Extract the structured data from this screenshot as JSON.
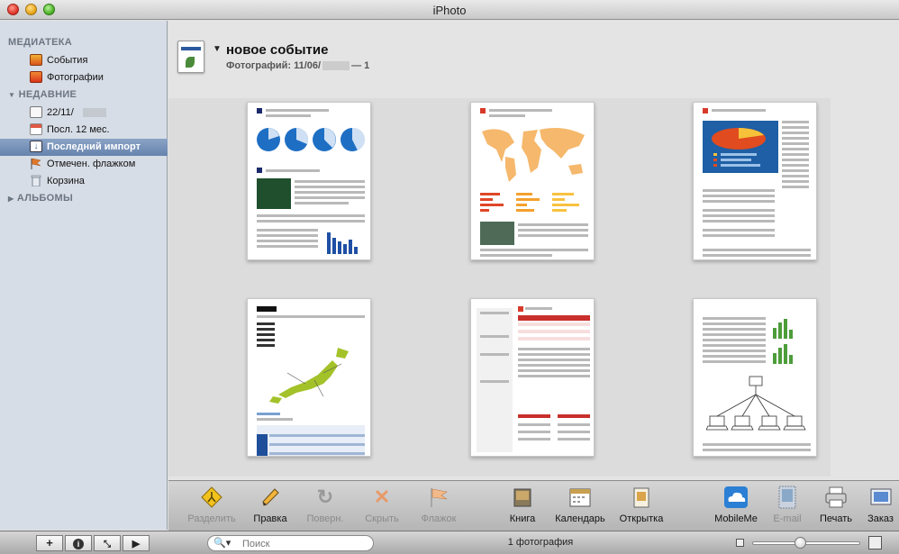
{
  "window": {
    "title": "iPhoto"
  },
  "sidebar": {
    "library_header": "МЕДИАТЕКА",
    "library_items": [
      {
        "label": "События",
        "icon": "events-icon",
        "color": "#e07b1b"
      },
      {
        "label": "Фотографии",
        "icon": "photos-icon",
        "color": "#e05a1b"
      }
    ],
    "recent_header": "НЕДАВНИЕ",
    "recent_items": [
      {
        "label": "22/11/",
        "icon": "event-album-icon",
        "color": "#f4f4f4"
      },
      {
        "label": "Посл. 12 мес.",
        "icon": "calendar-icon",
        "color": "#d94f3a"
      },
      {
        "label": "Последний импорт",
        "icon": "last-import-icon",
        "color": "#3d5f93"
      },
      {
        "label": "Отмечен. флажком",
        "icon": "flag-icon",
        "color": "#e0772b"
      },
      {
        "label": "Корзина",
        "icon": "trash-icon",
        "color": "#b0b7c0"
      }
    ],
    "albums_header": "АЛЬБОМЫ"
  },
  "event": {
    "title": "новое событие",
    "subtitle_prefix": "Фотографий: 11/06/",
    "subtitle_suffix": "— 1"
  },
  "toolbar": {
    "split": "Разделить",
    "edit": "Правка",
    "rotate": "Поверн.",
    "hide": "Скрыть",
    "flag": "Флажок",
    "book": "Книга",
    "calendar": "Календарь",
    "card": "Открытка",
    "mobileme": "MobileMe",
    "email": "E-mail",
    "print": "Печать",
    "order": "Заказ"
  },
  "status": {
    "search_placeholder": "Поиск",
    "count": "1 фотография"
  }
}
